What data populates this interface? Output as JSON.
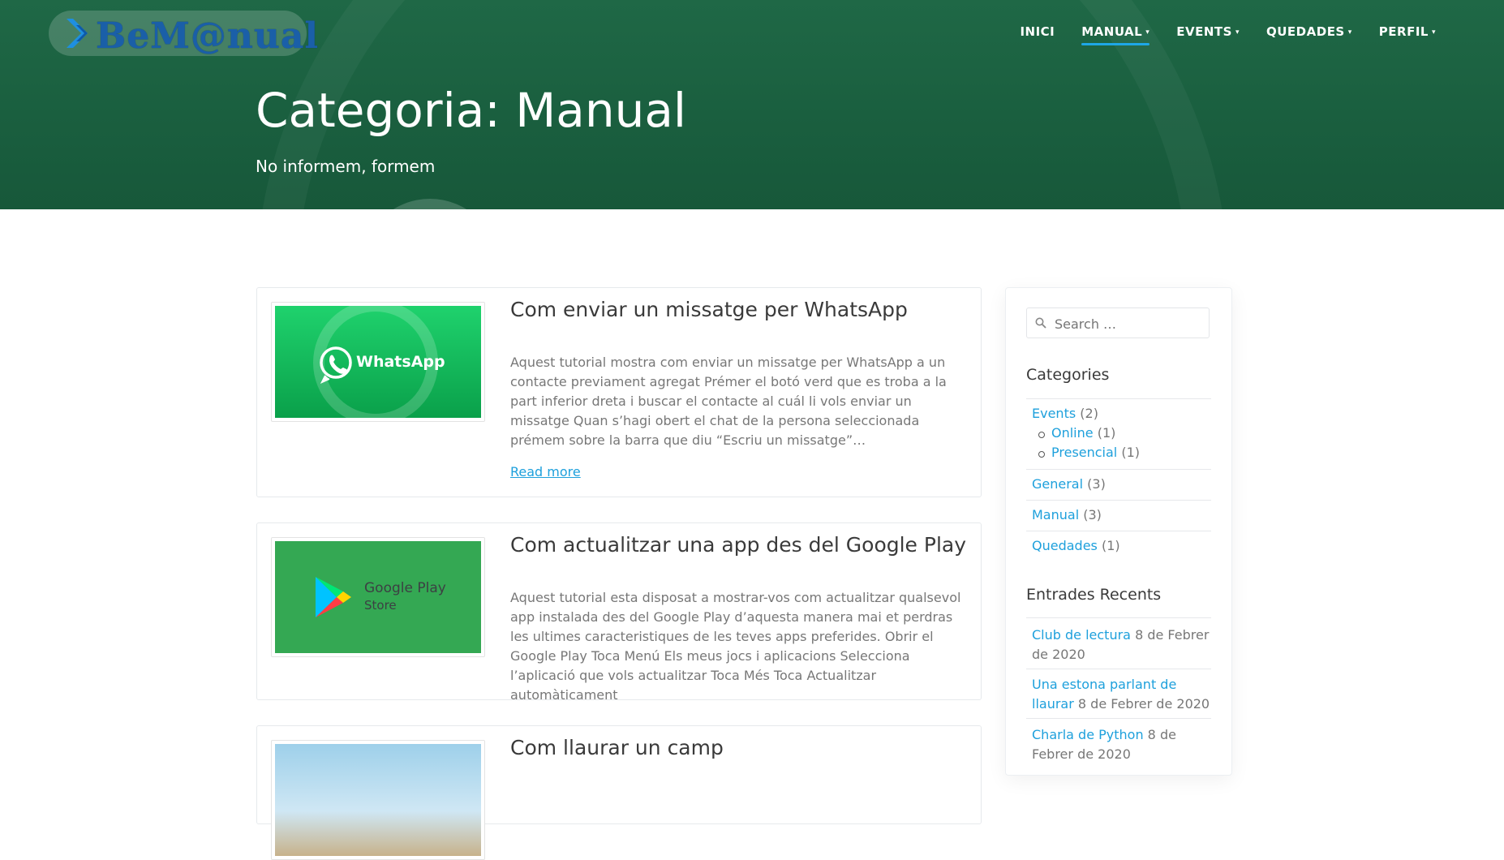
{
  "site": {
    "logo_text": "BeM@nual"
  },
  "nav": {
    "items": [
      {
        "label": "INICI",
        "has_caret": false,
        "active": false
      },
      {
        "label": "MANUAL",
        "has_caret": true,
        "active": true
      },
      {
        "label": "EVENTS",
        "has_caret": true,
        "active": false
      },
      {
        "label": "QUEDADES",
        "has_caret": true,
        "active": false
      },
      {
        "label": "PERFIL",
        "has_caret": true,
        "active": false
      }
    ],
    "caret": "▾"
  },
  "header": {
    "title": "Categoria: Manual",
    "tagline": "No informem, formem"
  },
  "posts": [
    {
      "title": "Com enviar un missatge per WhatsApp",
      "excerpt": "Aquest tutorial mostra com enviar un missatge per WhatsApp a un contacte previament agregat Prémer el botó verd que es troba a la part inferior dreta i buscar el contacte al cuál li vols enviar un missatge Quan s’hagi obert el chat de la persona seleccionada prémem sobre la barra que diu “Escriu un missatge”…",
      "read_more": "Read more",
      "thumb_text": "WhatsApp"
    },
    {
      "title": "Com actualitzar una app des del Google Play",
      "excerpt": "Aquest tutorial esta disposat a mostrar-vos com actualitzar qualsevol app instalada des del Google Play d’aquesta manera mai et perdras les ultimes caracteristiques de les teves apps preferides. Obrir el Google Play Toca Menú Els meus jocs i aplicacions Selecciona l’aplicació que vols actualitzar Toca Més Toca Actualitzar automàticament",
      "thumb_text_1": "Google Play",
      "thumb_text_2": "Store"
    },
    {
      "title": "Com llaurar un camp"
    }
  ],
  "sidebar": {
    "search_placeholder": "Search …",
    "categories_title": "Categories",
    "categories": [
      {
        "name": "Events",
        "count": "(2)"
      },
      {
        "name": "Online",
        "count": "(1)"
      },
      {
        "name": "Presencial",
        "count": "(1)"
      },
      {
        "name": "General",
        "count": "(3)"
      },
      {
        "name": "Manual",
        "count": "(3)"
      },
      {
        "name": "Quedades",
        "count": "(1)"
      }
    ],
    "recent_title": "Entrades Recents",
    "recent": [
      {
        "title": "Club de lectura",
        "date": "8 de Febrer de 2020"
      },
      {
        "title": "Una estona parlant de llaurar",
        "date": "8 de Febrer de 2020"
      },
      {
        "title": "Charla de Python",
        "date": "8 de Febrer de 2020"
      }
    ]
  },
  "colors": {
    "header_green": "#1a5f3f",
    "accent_blue": "#1ea0dc",
    "whatsapp_green": "#25d366",
    "google_play_green": "#34a853"
  }
}
